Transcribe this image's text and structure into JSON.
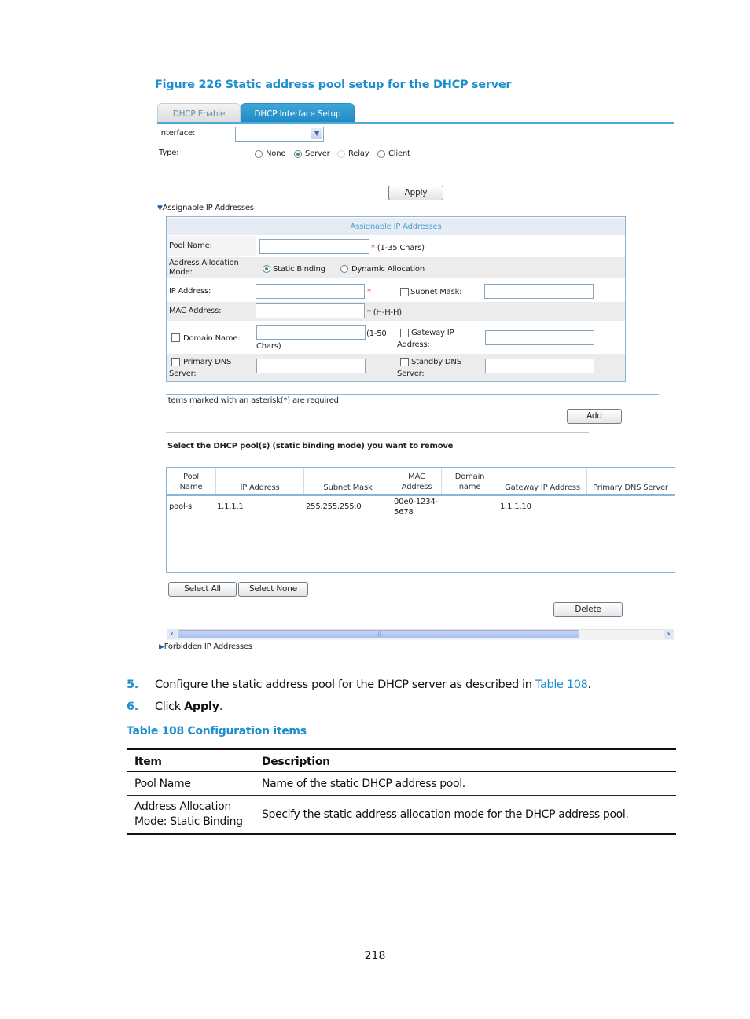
{
  "figure_caption": "Figure 226 Static address pool setup for the DHCP server",
  "tabs": [
    {
      "label": "DHCP Enable",
      "active": false
    },
    {
      "label": "DHCP Interface Setup",
      "active": true
    }
  ],
  "interface": {
    "label": "Interface:",
    "value": ""
  },
  "type": {
    "label": "Type:",
    "options": [
      {
        "label": "None",
        "selected": false
      },
      {
        "label": "Server",
        "selected": true
      },
      {
        "label": "Relay",
        "selected": false,
        "disabled": true
      },
      {
        "label": "Client",
        "selected": false
      }
    ]
  },
  "apply_label": "Apply",
  "assignable_section": {
    "toggle_label": "Assignable IP Addresses",
    "panel_title": "Assignable IP Addresses",
    "pool_name": {
      "label": "Pool Name:",
      "value": "",
      "required": "*",
      "hint": "(1-35 Chars)"
    },
    "allocation_mode": {
      "label_line1": "Address Allocation",
      "label_line2": "Mode:",
      "options": [
        {
          "label": "Static Binding",
          "selected": true
        },
        {
          "label": "Dynamic Allocation",
          "selected": false
        }
      ]
    },
    "ip_address": {
      "label": "IP Address:",
      "value": "",
      "required": "*"
    },
    "subnet_mask": {
      "label": "Subnet Mask:",
      "checked": false,
      "value": ""
    },
    "mac_address": {
      "label": "MAC Address:",
      "value": "",
      "required": "*",
      "hint": "(H-H-H)"
    },
    "domain_name": {
      "label": "Domain Name:",
      "checked": false,
      "value": "",
      "hint_line1": "(1-50",
      "hint_line2": "Chars)"
    },
    "gateway_ip": {
      "label_line1": "Gateway IP",
      "label_line2": "Address:",
      "checked": false,
      "value": ""
    },
    "primary_dns": {
      "label_line1": "Primary DNS",
      "label_line2": "Server:",
      "checked": false,
      "value": ""
    },
    "standby_dns": {
      "label_line1": "Standby DNS",
      "label_line2": "Server:",
      "checked": false,
      "value": ""
    }
  },
  "required_note": "Items marked with an asterisk(*) are required",
  "add_label": "Add",
  "remove_prompt": "Select the DHCP pool(s) (static binding mode) you want to remove",
  "pool_table": {
    "columns": [
      {
        "line1": "Pool",
        "line2": "Name"
      },
      {
        "line1": "",
        "line2": "IP Address"
      },
      {
        "line1": "",
        "line2": "Subnet Mask"
      },
      {
        "line1": "MAC",
        "line2": "Address"
      },
      {
        "line1": "Domain",
        "line2": "name"
      },
      {
        "line1": "",
        "line2": "Gateway IP Address"
      },
      {
        "line1": "",
        "line2": "Primary DNS Server"
      }
    ],
    "rows": [
      {
        "pool_name": "pool-s",
        "ip_address": "1.1.1.1",
        "subnet_mask": "255.255.255.0",
        "mac_line1": "00e0-1234-",
        "mac_line2": "5678",
        "domain_name": "",
        "gateway_ip": "1.1.1.10",
        "primary_dns": ""
      }
    ]
  },
  "select_all_label": "Select All",
  "select_none_label": "Select None",
  "delete_label": "Delete",
  "forbidden_section": {
    "toggle_label": "Forbidden IP Addresses"
  },
  "steps": [
    {
      "number": "5.",
      "text_before": "Configure the static address pool for the DHCP server as described in ",
      "link": "Table 108",
      "text_after": "."
    },
    {
      "number": "6.",
      "text_before": "Click ",
      "bold": "Apply",
      "text_after": "."
    }
  ],
  "table_caption": "Table 108 Configuration items",
  "config_table": {
    "headers": [
      "Item",
      "Description"
    ],
    "rows": [
      {
        "item_line1": "Pool Name",
        "item_line2": "",
        "description": "Name of the static DHCP address pool."
      },
      {
        "item_line1": "Address Allocation",
        "item_line2": "Mode: Static Binding",
        "description": "Specify the static address allocation mode for the DHCP address pool."
      }
    ]
  },
  "page_number": "218"
}
